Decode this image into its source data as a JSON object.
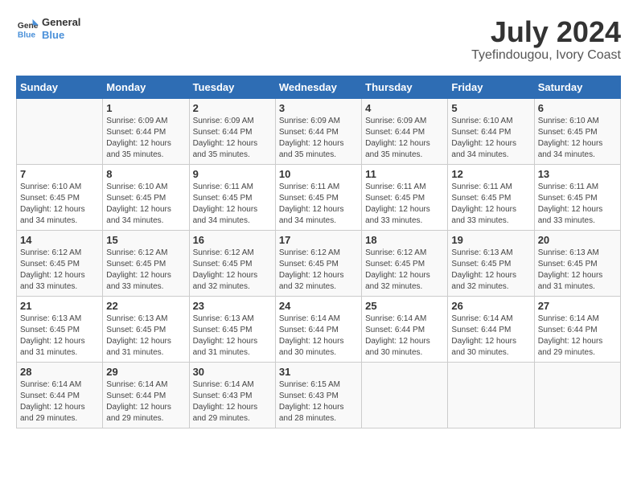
{
  "header": {
    "logo_line1": "General",
    "logo_line2": "Blue",
    "month": "July 2024",
    "location": "Tyefindougou, Ivory Coast"
  },
  "days_header": [
    "Sunday",
    "Monday",
    "Tuesday",
    "Wednesday",
    "Thursday",
    "Friday",
    "Saturday"
  ],
  "weeks": [
    [
      {
        "num": "",
        "detail": ""
      },
      {
        "num": "1",
        "detail": "Sunrise: 6:09 AM\nSunset: 6:44 PM\nDaylight: 12 hours\nand 35 minutes."
      },
      {
        "num": "2",
        "detail": "Sunrise: 6:09 AM\nSunset: 6:44 PM\nDaylight: 12 hours\nand 35 minutes."
      },
      {
        "num": "3",
        "detail": "Sunrise: 6:09 AM\nSunset: 6:44 PM\nDaylight: 12 hours\nand 35 minutes."
      },
      {
        "num": "4",
        "detail": "Sunrise: 6:09 AM\nSunset: 6:44 PM\nDaylight: 12 hours\nand 35 minutes."
      },
      {
        "num": "5",
        "detail": "Sunrise: 6:10 AM\nSunset: 6:44 PM\nDaylight: 12 hours\nand 34 minutes."
      },
      {
        "num": "6",
        "detail": "Sunrise: 6:10 AM\nSunset: 6:45 PM\nDaylight: 12 hours\nand 34 minutes."
      }
    ],
    [
      {
        "num": "7",
        "detail": "Sunrise: 6:10 AM\nSunset: 6:45 PM\nDaylight: 12 hours\nand 34 minutes."
      },
      {
        "num": "8",
        "detail": "Sunrise: 6:10 AM\nSunset: 6:45 PM\nDaylight: 12 hours\nand 34 minutes."
      },
      {
        "num": "9",
        "detail": "Sunrise: 6:11 AM\nSunset: 6:45 PM\nDaylight: 12 hours\nand 34 minutes."
      },
      {
        "num": "10",
        "detail": "Sunrise: 6:11 AM\nSunset: 6:45 PM\nDaylight: 12 hours\nand 34 minutes."
      },
      {
        "num": "11",
        "detail": "Sunrise: 6:11 AM\nSunset: 6:45 PM\nDaylight: 12 hours\nand 33 minutes."
      },
      {
        "num": "12",
        "detail": "Sunrise: 6:11 AM\nSunset: 6:45 PM\nDaylight: 12 hours\nand 33 minutes."
      },
      {
        "num": "13",
        "detail": "Sunrise: 6:11 AM\nSunset: 6:45 PM\nDaylight: 12 hours\nand 33 minutes."
      }
    ],
    [
      {
        "num": "14",
        "detail": "Sunrise: 6:12 AM\nSunset: 6:45 PM\nDaylight: 12 hours\nand 33 minutes."
      },
      {
        "num": "15",
        "detail": "Sunrise: 6:12 AM\nSunset: 6:45 PM\nDaylight: 12 hours\nand 33 minutes."
      },
      {
        "num": "16",
        "detail": "Sunrise: 6:12 AM\nSunset: 6:45 PM\nDaylight: 12 hours\nand 32 minutes."
      },
      {
        "num": "17",
        "detail": "Sunrise: 6:12 AM\nSunset: 6:45 PM\nDaylight: 12 hours\nand 32 minutes."
      },
      {
        "num": "18",
        "detail": "Sunrise: 6:12 AM\nSunset: 6:45 PM\nDaylight: 12 hours\nand 32 minutes."
      },
      {
        "num": "19",
        "detail": "Sunrise: 6:13 AM\nSunset: 6:45 PM\nDaylight: 12 hours\nand 32 minutes."
      },
      {
        "num": "20",
        "detail": "Sunrise: 6:13 AM\nSunset: 6:45 PM\nDaylight: 12 hours\nand 31 minutes."
      }
    ],
    [
      {
        "num": "21",
        "detail": "Sunrise: 6:13 AM\nSunset: 6:45 PM\nDaylight: 12 hours\nand 31 minutes."
      },
      {
        "num": "22",
        "detail": "Sunrise: 6:13 AM\nSunset: 6:45 PM\nDaylight: 12 hours\nand 31 minutes."
      },
      {
        "num": "23",
        "detail": "Sunrise: 6:13 AM\nSunset: 6:45 PM\nDaylight: 12 hours\nand 31 minutes."
      },
      {
        "num": "24",
        "detail": "Sunrise: 6:14 AM\nSunset: 6:44 PM\nDaylight: 12 hours\nand 30 minutes."
      },
      {
        "num": "25",
        "detail": "Sunrise: 6:14 AM\nSunset: 6:44 PM\nDaylight: 12 hours\nand 30 minutes."
      },
      {
        "num": "26",
        "detail": "Sunrise: 6:14 AM\nSunset: 6:44 PM\nDaylight: 12 hours\nand 30 minutes."
      },
      {
        "num": "27",
        "detail": "Sunrise: 6:14 AM\nSunset: 6:44 PM\nDaylight: 12 hours\nand 29 minutes."
      }
    ],
    [
      {
        "num": "28",
        "detail": "Sunrise: 6:14 AM\nSunset: 6:44 PM\nDaylight: 12 hours\nand 29 minutes."
      },
      {
        "num": "29",
        "detail": "Sunrise: 6:14 AM\nSunset: 6:44 PM\nDaylight: 12 hours\nand 29 minutes."
      },
      {
        "num": "30",
        "detail": "Sunrise: 6:14 AM\nSunset: 6:43 PM\nDaylight: 12 hours\nand 29 minutes."
      },
      {
        "num": "31",
        "detail": "Sunrise: 6:15 AM\nSunset: 6:43 PM\nDaylight: 12 hours\nand 28 minutes."
      },
      {
        "num": "",
        "detail": ""
      },
      {
        "num": "",
        "detail": ""
      },
      {
        "num": "",
        "detail": ""
      }
    ]
  ]
}
